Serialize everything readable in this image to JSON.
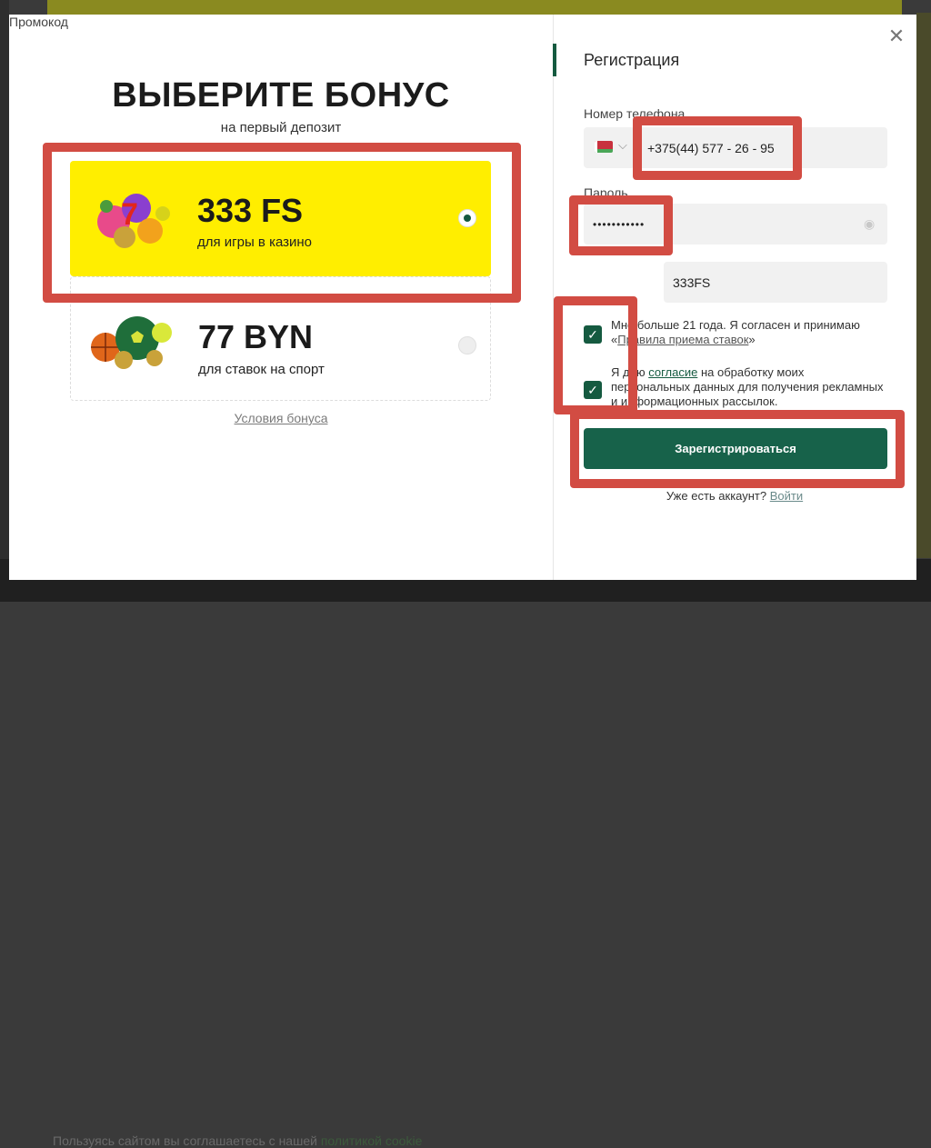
{
  "background": {
    "footer_text": "Пользуясь сайтом вы соглашаетесь с нашей",
    "footer_link": "политикой cookie"
  },
  "modal": {
    "close_icon": "close-icon",
    "left": {
      "title": "ВЫБЕРИТЕ БОНУС",
      "subtitle": "на первый депозит",
      "bonuses": [
        {
          "amount": "333 FS",
          "description": "для игры в казино",
          "selected": true,
          "icon": "casino-slots-icon"
        },
        {
          "amount": "77 BYN",
          "description": "для ставок на спорт",
          "selected": false,
          "icon": "sport-balls-icon"
        }
      ],
      "terms_link": "Условия бонуса"
    },
    "right": {
      "title": "Регистрация",
      "phone": {
        "label": "Номер телефона",
        "country_icon": "belarus-flag-icon",
        "value": "+375(44) 577 - 26 - 95"
      },
      "password": {
        "label": "Пароль",
        "value": "•••••••••••"
      },
      "promo": {
        "label": "Промокод",
        "value": "333FS"
      },
      "age_check": {
        "text": "Мне больше 21 года. Я согласен и принимаю «",
        "link": "Правила приема ставок",
        "text_end": "»",
        "checked": true
      },
      "consent_check": {
        "text": "Я даю ",
        "link": "согласие",
        "text_end": " на обработку моих персональных данных для получения рекламных и информационных рассылок.",
        "checked": true
      },
      "submit_label": "Зарегистрироваться",
      "login_prompt": "Уже есть аккаунт?",
      "login_link": "Войти"
    }
  },
  "colors": {
    "brand_green": "#17624a",
    "bonus_yellow": "#ffee00",
    "annotation_red": "#d24c43"
  }
}
